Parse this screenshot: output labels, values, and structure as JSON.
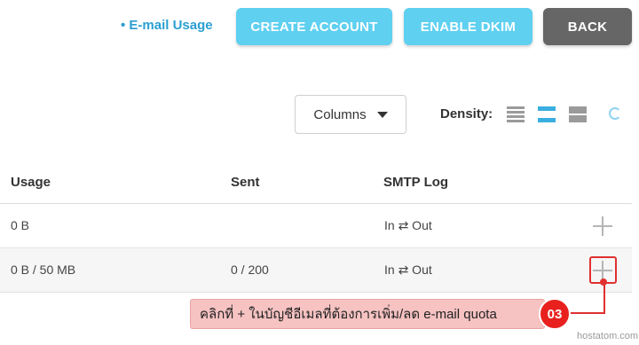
{
  "header": {
    "usage_link": "• E-mail Usage",
    "create_account": "CREATE ACCOUNT",
    "enable_dkim": "ENABLE DKIM",
    "back": "BACK"
  },
  "toolbar": {
    "columns_label": "Columns",
    "density_label": "Density:"
  },
  "table": {
    "headers": {
      "usage": "Usage",
      "sent": "Sent",
      "smtp_log": "SMTP Log"
    },
    "rows": [
      {
        "usage": "0 B",
        "sent": "",
        "smtp_log": "In ⇄ Out"
      },
      {
        "usage": "0 B / 50 MB",
        "sent": "0 / 200",
        "smtp_log": "In ⇄ Out"
      }
    ]
  },
  "annotation": {
    "callout_text": "คลิกที่ + ในบัญชีอีเมลที่ต้องการเพิ่ม/ลด e-mail quota",
    "step": "03",
    "watermark": "hostatom.com",
    "accent_color": "#e8211e"
  },
  "colors": {
    "primary_button": "#5fd0f0",
    "back_button": "#666666",
    "link": "#2b9fd2"
  }
}
